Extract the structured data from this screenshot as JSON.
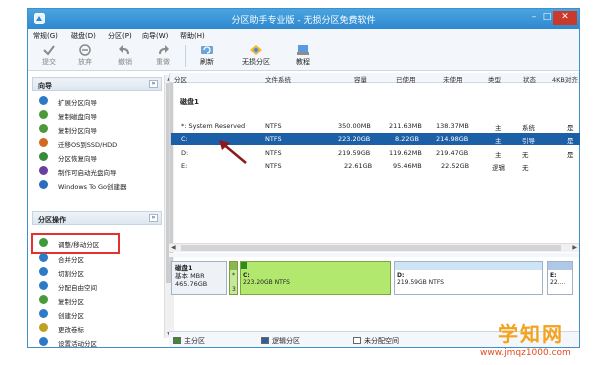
{
  "window": {
    "title": "分区助手专业版 - 无损分区免费软件",
    "min": "–",
    "max": "□",
    "close": "✕"
  },
  "menu": [
    "常规(G)",
    "磁盘(D)",
    "分区(P)",
    "向导(W)",
    "帮助(H)"
  ],
  "toolbar": [
    {
      "label": "提交",
      "icon": "check-icon",
      "disabled": true
    },
    {
      "label": "放弃",
      "icon": "discard-icon",
      "disabled": true
    },
    {
      "label": "撤销",
      "icon": "undo-icon",
      "disabled": true
    },
    {
      "label": "重做",
      "icon": "redo-icon",
      "disabled": true
    },
    {
      "label": "刷新",
      "icon": "refresh-icon",
      "disabled": false
    },
    {
      "label": "无损分区",
      "icon": "lossless-partition-icon",
      "disabled": false
    },
    {
      "label": "教程",
      "icon": "tutorial-icon",
      "disabled": false
    }
  ],
  "wizard": {
    "title": "向导",
    "collapse": "»",
    "items": [
      {
        "label": "扩展分区向导",
        "color": "#2f79c9"
      },
      {
        "label": "复制磁盘向导",
        "color": "#4b9a3a"
      },
      {
        "label": "复制分区向导",
        "color": "#4b9a3a"
      },
      {
        "label": "迁移OS到SSD/HDD",
        "color": "#d2691e"
      },
      {
        "label": "分区恢复向导",
        "color": "#3a8a3a"
      },
      {
        "label": "制作可启动光盘向导",
        "color": "#6a3fa0"
      },
      {
        "label": "Windows To Go创建器",
        "color": "#2b6ec0"
      }
    ]
  },
  "partops": {
    "title": "分区操作",
    "collapse": "»",
    "items": [
      {
        "label": "调整/移动分区",
        "color": "#3d9a3d"
      },
      {
        "label": "合并分区",
        "color": "#2f79c9"
      },
      {
        "label": "切割分区",
        "color": "#2f79c9"
      },
      {
        "label": "分配自由空间",
        "color": "#2f79c9"
      },
      {
        "label": "复制分区",
        "color": "#4b9a3a"
      },
      {
        "label": "创建分区",
        "color": "#2f79c9"
      },
      {
        "label": "更改卷标",
        "color": "#c0a020"
      },
      {
        "label": "设置活动分区",
        "color": "#2f79c9"
      }
    ]
  },
  "table": {
    "headers": [
      "分区",
      "文件系统",
      "容量",
      "已使用",
      "未使用",
      "类型",
      "状态",
      "4KB对齐"
    ],
    "disk_label": "磁盘1",
    "rows": [
      {
        "part": "*: System Reserved",
        "fs": "NTFS",
        "cap": "350.00MB",
        "used": "211.63MB",
        "free": "138.37MB",
        "type": "主",
        "status": "系统",
        "align": "是"
      },
      {
        "part": "C:",
        "fs": "NTFS",
        "cap": "223.20GB",
        "used": "8.22GB",
        "free": "214.98GB",
        "type": "主",
        "status": "引导",
        "align": "是"
      },
      {
        "part": "D:",
        "fs": "NTFS",
        "cap": "219.59GB",
        "used": "119.62MB",
        "free": "219.47GB",
        "type": "主",
        "status": "无",
        "align": "是"
      },
      {
        "part": "E:",
        "fs": "NTFS",
        "cap": "22.61GB",
        "used": "95.46MB",
        "free": "22.52GB",
        "type": "逻辑",
        "status": "无",
        "align": ""
      }
    ],
    "selected_row": 1
  },
  "diskmap": {
    "disk_name": "磁盘1",
    "disk_type": "基本 MBR",
    "disk_size": "465.76GB",
    "sys_label": "*",
    "sys_size": "3",
    "c_name": "C:",
    "c_info": "223.20GB NTFS",
    "d_name": "D:",
    "d_info": "219.59GB NTFS",
    "e_name": "E:",
    "e_info": "22...."
  },
  "legend": [
    {
      "label": "主分区",
      "color": "#3d8b2a"
    },
    {
      "label": "逻辑分区",
      "color": "#2f5e9e"
    },
    {
      "label": "未分配空间",
      "color": "#ffffff"
    }
  ],
  "watermark": {
    "title": "学知网",
    "url": "www.jmqz1000.com"
  }
}
